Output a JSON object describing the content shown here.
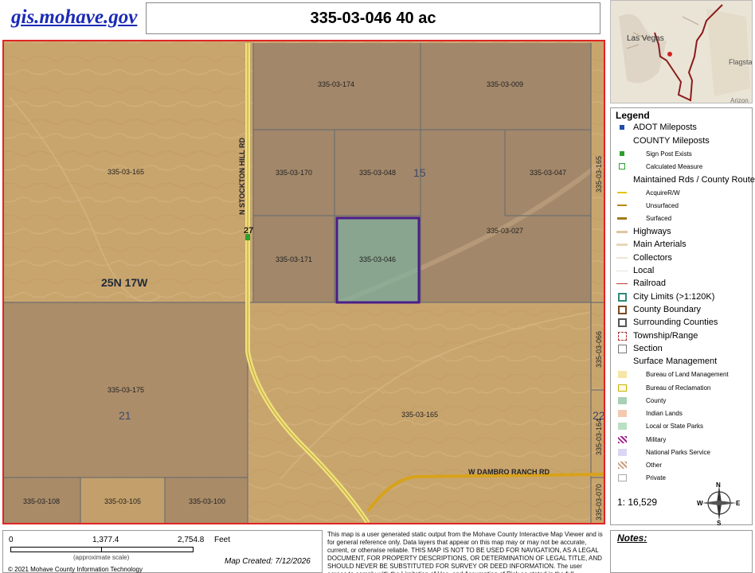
{
  "header": {
    "site_link": "gis.mohave.gov",
    "title": "335-03-046  40 ac"
  },
  "inset_map": {
    "city_1": "Las Vegas",
    "city_2": "Flagsta",
    "city_3": "Arizon"
  },
  "map": {
    "road_vertical": "N STOCKTON HILL RD",
    "road_horizontal": "W DAMBRO RANCH RD",
    "milepost": "27",
    "township_range": "25N 17W",
    "section_15": "15",
    "section_21": "21",
    "section_22": "22",
    "selected_parcel": "335-03-046",
    "parcels": {
      "p165_nw": "335-03-165",
      "p174": "335-03-174",
      "p009": "335-03-009",
      "p170": "335-03-170",
      "p048": "335-03-048",
      "p047": "335-03-047",
      "p027": "335-03-027",
      "p171": "335-03-171",
      "p046": "335-03-046",
      "p175": "335-03-175",
      "p165_s": "335-03-165",
      "p108": "335-03-108",
      "p105": "335-03-105",
      "p100": "335-03-100",
      "p165_e": "335-03-165",
      "p066": "335-03-066",
      "p164": "335-03-164",
      "p070": "335-03-070"
    },
    "colors": {
      "desert": "#c9a56e",
      "parcel_fill": "#9e8466",
      "selected_outline": "#4b1e8a",
      "county_green": "#8fb39a",
      "road_yellow": "#f0e07a",
      "road_orange": "#d8a21a",
      "frame_red": "#e02525"
    }
  },
  "legend": {
    "title": "Legend",
    "items": [
      {
        "label": "ADOT Mileposts",
        "size": "big"
      },
      {
        "label": "COUNTY Mileposts",
        "size": "big"
      },
      {
        "label": "Sign Post Exists",
        "size": "small"
      },
      {
        "label": "Calculated Measure",
        "size": "small"
      },
      {
        "label": "Maintained Rds / County Routes",
        "size": "big"
      },
      {
        "label": "AcquireR/W",
        "size": "small"
      },
      {
        "label": "Unsurfaced",
        "size": "small"
      },
      {
        "label": "Surfaced",
        "size": "small"
      },
      {
        "label": "Highways",
        "size": "big"
      },
      {
        "label": "Main Arterials",
        "size": "big"
      },
      {
        "label": "Collectors",
        "size": "big"
      },
      {
        "label": "Local",
        "size": "big"
      },
      {
        "label": "Railroad",
        "size": "big"
      },
      {
        "label": "City Limits (>1:120K)",
        "size": "big"
      },
      {
        "label": "County Boundary",
        "size": "big"
      },
      {
        "label": "Surrounding Counties",
        "size": "big"
      },
      {
        "label": "Township/Range",
        "size": "big"
      },
      {
        "label": "Section",
        "size": "big"
      },
      {
        "label": "Surface Management",
        "size": "big"
      },
      {
        "label": "Bureau of Land Management",
        "size": "small"
      },
      {
        "label": "Bureau of Reclamation",
        "size": "small"
      },
      {
        "label": "County",
        "size": "small"
      },
      {
        "label": "Indian Lands",
        "size": "small"
      },
      {
        "label": "Local or State Parks",
        "size": "small"
      },
      {
        "label": "Military",
        "size": "small"
      },
      {
        "label": "National Parks Service",
        "size": "small"
      },
      {
        "label": "Other",
        "size": "small"
      },
      {
        "label": "Private",
        "size": "small"
      }
    ],
    "scale_ratio": "1: 16,529",
    "compass": {
      "n": "N",
      "s": "S",
      "e": "E",
      "w": "W"
    }
  },
  "footer": {
    "scale_0": "0",
    "scale_1": "1,377.4",
    "scale_2": "2,754.8",
    "scale_unit": "Feet",
    "scale_note": "(approximate scale)",
    "map_created": "Map Created: 7/12/2026",
    "copyright": "© 2021 Mohave County Information Technology",
    "disclaimer": "This map is a user generated static output from the Mohave County Interactive Map Viewer and is for general reference only. Data layers that appear on this map may or may not be accurate, current, or otherwise reliable. THIS MAP IS NOT TO BE USED FOR NAVIGATION, AS A LEGAL DOCUMENT, FOR PROPERTY DESCRIPTIONS, OR DETERMINATION OF LEGAL TITLE, AND SHOULD NEVER BE SUBSTITUTED FOR SURVEY OR DEED INFORMATION. The user agrees to comply with the Limitation of Use, and Assumption of Risk as stated in the full disclaimer at https://gis.mohave.gov",
    "notes_label": "Notes:"
  }
}
